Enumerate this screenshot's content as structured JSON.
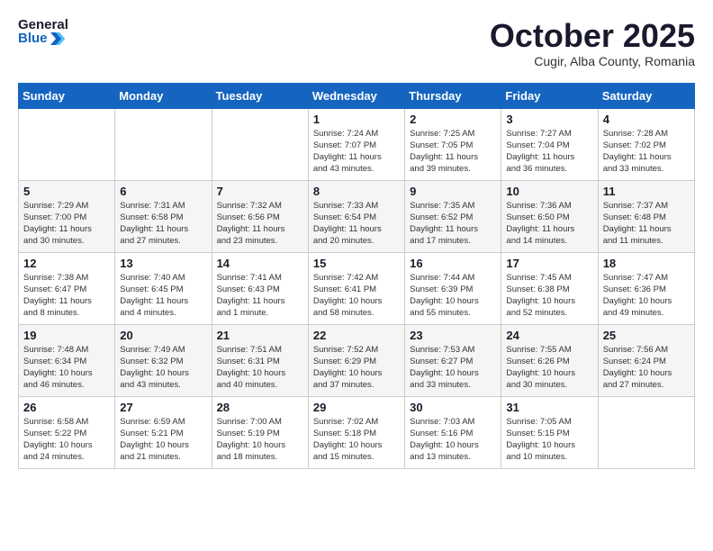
{
  "logo": {
    "text_general": "General",
    "text_blue": "Blue"
  },
  "header": {
    "month": "October 2025",
    "location": "Cugir, Alba County, Romania"
  },
  "weekdays": [
    "Sunday",
    "Monday",
    "Tuesday",
    "Wednesday",
    "Thursday",
    "Friday",
    "Saturday"
  ],
  "weeks": [
    [
      {
        "date": "",
        "content": ""
      },
      {
        "date": "",
        "content": ""
      },
      {
        "date": "",
        "content": ""
      },
      {
        "date": "1",
        "content": "Sunrise: 7:24 AM\nSunset: 7:07 PM\nDaylight: 11 hours\nand 43 minutes."
      },
      {
        "date": "2",
        "content": "Sunrise: 7:25 AM\nSunset: 7:05 PM\nDaylight: 11 hours\nand 39 minutes."
      },
      {
        "date": "3",
        "content": "Sunrise: 7:27 AM\nSunset: 7:04 PM\nDaylight: 11 hours\nand 36 minutes."
      },
      {
        "date": "4",
        "content": "Sunrise: 7:28 AM\nSunset: 7:02 PM\nDaylight: 11 hours\nand 33 minutes."
      }
    ],
    [
      {
        "date": "5",
        "content": "Sunrise: 7:29 AM\nSunset: 7:00 PM\nDaylight: 11 hours\nand 30 minutes."
      },
      {
        "date": "6",
        "content": "Sunrise: 7:31 AM\nSunset: 6:58 PM\nDaylight: 11 hours\nand 27 minutes."
      },
      {
        "date": "7",
        "content": "Sunrise: 7:32 AM\nSunset: 6:56 PM\nDaylight: 11 hours\nand 23 minutes."
      },
      {
        "date": "8",
        "content": "Sunrise: 7:33 AM\nSunset: 6:54 PM\nDaylight: 11 hours\nand 20 minutes."
      },
      {
        "date": "9",
        "content": "Sunrise: 7:35 AM\nSunset: 6:52 PM\nDaylight: 11 hours\nand 17 minutes."
      },
      {
        "date": "10",
        "content": "Sunrise: 7:36 AM\nSunset: 6:50 PM\nDaylight: 11 hours\nand 14 minutes."
      },
      {
        "date": "11",
        "content": "Sunrise: 7:37 AM\nSunset: 6:48 PM\nDaylight: 11 hours\nand 11 minutes."
      }
    ],
    [
      {
        "date": "12",
        "content": "Sunrise: 7:38 AM\nSunset: 6:47 PM\nDaylight: 11 hours\nand 8 minutes."
      },
      {
        "date": "13",
        "content": "Sunrise: 7:40 AM\nSunset: 6:45 PM\nDaylight: 11 hours\nand 4 minutes."
      },
      {
        "date": "14",
        "content": "Sunrise: 7:41 AM\nSunset: 6:43 PM\nDaylight: 11 hours\nand 1 minute."
      },
      {
        "date": "15",
        "content": "Sunrise: 7:42 AM\nSunset: 6:41 PM\nDaylight: 10 hours\nand 58 minutes."
      },
      {
        "date": "16",
        "content": "Sunrise: 7:44 AM\nSunset: 6:39 PM\nDaylight: 10 hours\nand 55 minutes."
      },
      {
        "date": "17",
        "content": "Sunrise: 7:45 AM\nSunset: 6:38 PM\nDaylight: 10 hours\nand 52 minutes."
      },
      {
        "date": "18",
        "content": "Sunrise: 7:47 AM\nSunset: 6:36 PM\nDaylight: 10 hours\nand 49 minutes."
      }
    ],
    [
      {
        "date": "19",
        "content": "Sunrise: 7:48 AM\nSunset: 6:34 PM\nDaylight: 10 hours\nand 46 minutes."
      },
      {
        "date": "20",
        "content": "Sunrise: 7:49 AM\nSunset: 6:32 PM\nDaylight: 10 hours\nand 43 minutes."
      },
      {
        "date": "21",
        "content": "Sunrise: 7:51 AM\nSunset: 6:31 PM\nDaylight: 10 hours\nand 40 minutes."
      },
      {
        "date": "22",
        "content": "Sunrise: 7:52 AM\nSunset: 6:29 PM\nDaylight: 10 hours\nand 37 minutes."
      },
      {
        "date": "23",
        "content": "Sunrise: 7:53 AM\nSunset: 6:27 PM\nDaylight: 10 hours\nand 33 minutes."
      },
      {
        "date": "24",
        "content": "Sunrise: 7:55 AM\nSunset: 6:26 PM\nDaylight: 10 hours\nand 30 minutes."
      },
      {
        "date": "25",
        "content": "Sunrise: 7:56 AM\nSunset: 6:24 PM\nDaylight: 10 hours\nand 27 minutes."
      }
    ],
    [
      {
        "date": "26",
        "content": "Sunrise: 6:58 AM\nSunset: 5:22 PM\nDaylight: 10 hours\nand 24 minutes."
      },
      {
        "date": "27",
        "content": "Sunrise: 6:59 AM\nSunset: 5:21 PM\nDaylight: 10 hours\nand 21 minutes."
      },
      {
        "date": "28",
        "content": "Sunrise: 7:00 AM\nSunset: 5:19 PM\nDaylight: 10 hours\nand 18 minutes."
      },
      {
        "date": "29",
        "content": "Sunrise: 7:02 AM\nSunset: 5:18 PM\nDaylight: 10 hours\nand 15 minutes."
      },
      {
        "date": "30",
        "content": "Sunrise: 7:03 AM\nSunset: 5:16 PM\nDaylight: 10 hours\nand 13 minutes."
      },
      {
        "date": "31",
        "content": "Sunrise: 7:05 AM\nSunset: 5:15 PM\nDaylight: 10 hours\nand 10 minutes."
      },
      {
        "date": "",
        "content": ""
      }
    ]
  ]
}
